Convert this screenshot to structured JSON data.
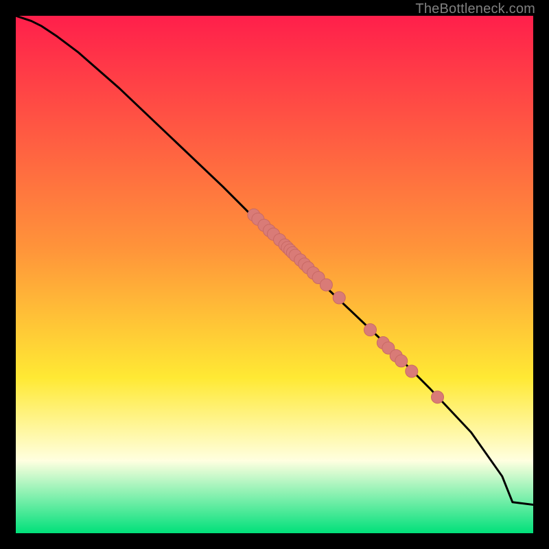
{
  "watermark": "TheBottleneck.com",
  "colors": {
    "gradient_top": "#ff1f4b",
    "gradient_mid_upper": "#ff943a",
    "gradient_mid": "#ffe934",
    "gradient_pale": "#ffffe0",
    "gradient_bottom": "#00e07a",
    "curve": "#000000",
    "marker_fill": "#d97b77",
    "marker_stroke": "#c86964"
  },
  "chart_data": {
    "type": "line",
    "title": "",
    "xlabel": "",
    "ylabel": "",
    "xlim": [
      0,
      100
    ],
    "ylim": [
      0,
      100
    ],
    "curve": {
      "x": [
        0,
        3,
        5,
        8,
        12,
        20,
        30,
        40,
        50,
        60,
        70,
        80,
        88,
        94,
        96,
        100
      ],
      "y": [
        100,
        99,
        98,
        96,
        93,
        86,
        76.5,
        67,
        57,
        47.5,
        38,
        28,
        19.5,
        11,
        6,
        5.5
      ]
    },
    "series": [
      {
        "name": "cluster-points",
        "type": "scatter",
        "x": [
          46,
          46.8,
          48,
          49,
          49.8,
          49.8,
          51,
          52,
          52.5,
          53,
          53.5,
          54,
          55,
          55.8,
          56.5,
          57.5,
          58.5,
          60,
          62.5,
          68.5,
          71,
          72,
          73.5,
          74.5,
          76.5,
          81.5
        ],
        "y": [
          61.5,
          60.7,
          59.5,
          58.5,
          57.8,
          57.8,
          56.7,
          55.7,
          55.2,
          54.7,
          54.2,
          53.7,
          52.8,
          52.0,
          51.3,
          50.3,
          49.4,
          48.0,
          45.5,
          39.3,
          36.8,
          35.8,
          34.3,
          33.3,
          31.3,
          26.3
        ]
      }
    ]
  }
}
